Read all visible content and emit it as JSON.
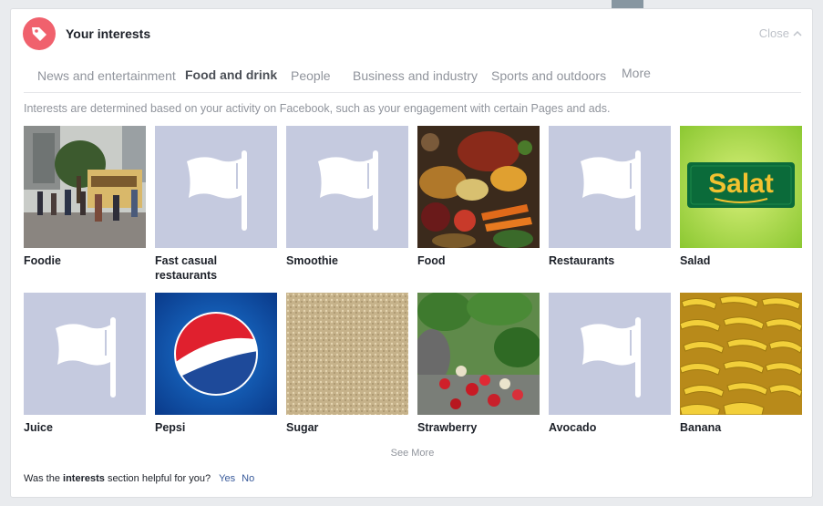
{
  "header": {
    "title": "Your interests",
    "close_label": "Close"
  },
  "tabs": [
    {
      "label": "News and entertainment",
      "active": false
    },
    {
      "label": "Food and drink",
      "active": true
    },
    {
      "label": "People",
      "active": false
    },
    {
      "label": "Business and industry",
      "active": false
    },
    {
      "label": "Sports and outdoors",
      "active": false
    },
    {
      "label": "More",
      "active": false
    }
  ],
  "description": "Interests are determined based on your activity on Facebook, such as your engagement with certain Pages and ads.",
  "interests": [
    {
      "label": "Foodie",
      "image": "photo-food-trucks"
    },
    {
      "label": "Fast casual restaurants",
      "image": "flag-placeholder-icon"
    },
    {
      "label": "Smoothie",
      "image": "flag-placeholder-icon"
    },
    {
      "label": "Food",
      "image": "photo-food-spread"
    },
    {
      "label": "Restaurants",
      "image": "flag-placeholder-icon"
    },
    {
      "label": "Salad",
      "image": "logo-salat",
      "logo_text": "Salat"
    },
    {
      "label": "Juice",
      "image": "flag-placeholder-icon"
    },
    {
      "label": "Pepsi",
      "image": "logo-pepsi"
    },
    {
      "label": "Sugar",
      "image": "photo-sugar"
    },
    {
      "label": "Strawberry",
      "image": "photo-strawberry-plant"
    },
    {
      "label": "Avocado",
      "image": "flag-placeholder-icon"
    },
    {
      "label": "Banana",
      "image": "photo-bananas"
    }
  ],
  "see_more": "See More",
  "feedback": {
    "prefix": "Was the",
    "bold": "interests",
    "suffix": "section helpful for you?",
    "yes": "Yes",
    "no": "No"
  },
  "colors": {
    "badge": "#f0616d",
    "placeholder": "#c5cadf",
    "link": "#365899"
  }
}
